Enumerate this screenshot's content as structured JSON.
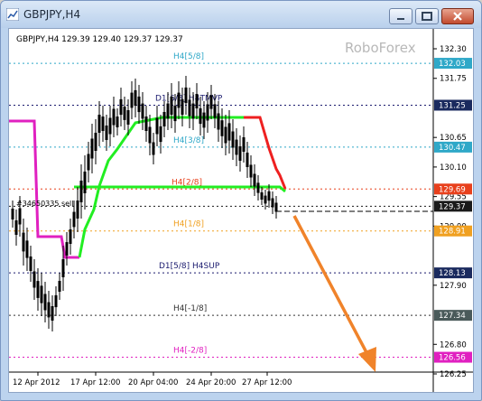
{
  "window": {
    "title": "GBPJPY,H4"
  },
  "chart": {
    "info_line": "GBPJPY,H4  129.39 129.40 129.37 129.37",
    "watermark": "RoboForex",
    "order_label": "#34650335 sell",
    "y_ticks": [
      "132.30",
      "131.75",
      "130.65",
      "130.10",
      "129.55",
      "129.00",
      "127.90",
      "126.80",
      "126.25"
    ],
    "x_ticks": [
      "12 Apr 2012",
      "17 Apr 12:00",
      "20 Apr 04:00",
      "24 Apr 20:00",
      "27 Apr 12:00"
    ],
    "levels": [
      {
        "label": "H4[5/8]",
        "price": "132.03",
        "color": "#2fa8c8",
        "tag_bg": "#2fa8c8"
      },
      {
        "label": "D1[6/8] H4TMVP",
        "price": "131.25",
        "color": "#1a1a6e",
        "tag_bg": "#1a2a5e"
      },
      {
        "label": "H4[3/8]",
        "price": "130.47",
        "color": "#2fa8c8",
        "tag_bg": "#2fa8c8"
      },
      {
        "label": "H4[2/8]",
        "price": "129.69",
        "color": "#e8401c",
        "tag_bg": "#e8401c"
      },
      {
        "label": "",
        "price": "129.37",
        "color": "#1a1a1a",
        "tag_bg": "#1a1a1a"
      },
      {
        "label": "H4[1/8]",
        "price": "128.91",
        "color": "#f0a020",
        "tag_bg": "#f0a020"
      },
      {
        "label": "D1[5/8] H4SUP",
        "price": "128.13",
        "color": "#1a1a6e",
        "tag_bg": "#1a2a5e"
      },
      {
        "label": "H4[-1/8]",
        "price": "127.34",
        "color": "#333333",
        "tag_bg": "#4a5a5a"
      },
      {
        "label": "H4[-2/8]",
        "price": "126.56",
        "color": "#e020c0",
        "tag_bg": "#e020c0"
      }
    ],
    "colors": {
      "magenta_line": "#e020c0",
      "green_line": "#22ee22",
      "red_line": "#ee2020",
      "arrow": "#f0832a",
      "candles": "#000000"
    }
  }
}
